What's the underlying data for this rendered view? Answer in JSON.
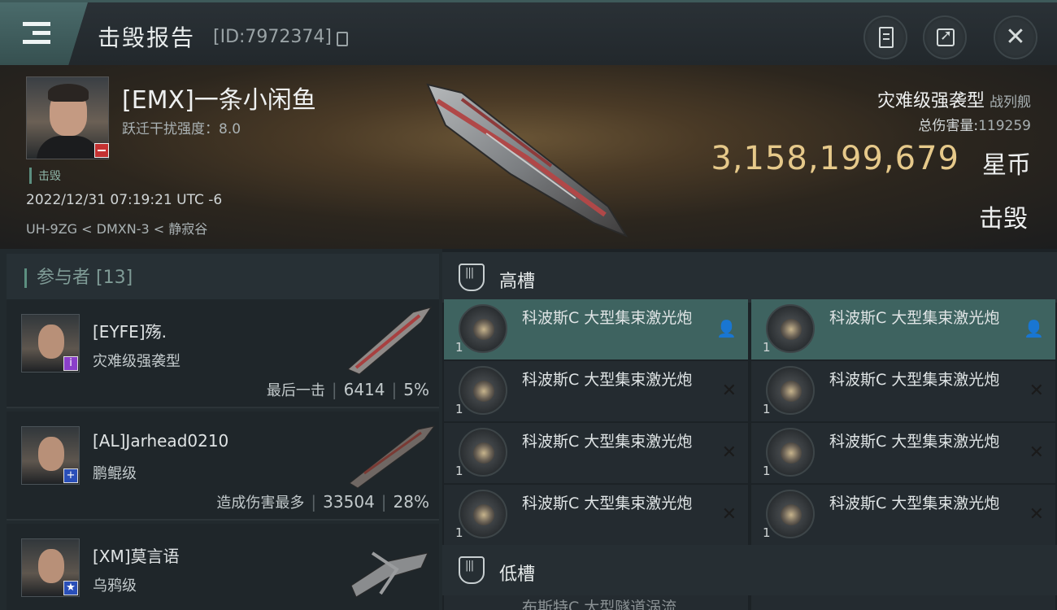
{
  "header": {
    "title": "击毁报告",
    "report_id": "[ID:7972374]"
  },
  "victim": {
    "name": "[EMX]一条小闲鱼",
    "warp_scramble": "跃迁干扰强度：8.0",
    "tag": "击毁",
    "datetime": "2022/12/31 07:19:21 UTC -6",
    "location": "UH-9ZG < DMXN-3 < 静寂谷",
    "ship_name": "灾难级强袭型",
    "ship_class": "战列舰",
    "total_damage_label": "总伤害量:",
    "total_damage_value": "119259",
    "isk_value": "3,158,199,679",
    "isk_unit": "星币",
    "status": "击毁"
  },
  "participants": {
    "header": "参与者 [13]",
    "rows": [
      {
        "name": "[EYFE]殇.",
        "ship": "灾难级强袭型",
        "label": "最后一击",
        "damage": "6414",
        "percent": "5%",
        "badge_color": "#8a3fc9",
        "badge_glyph": "i"
      },
      {
        "name": "[AL]Jarhead0210",
        "ship": "鹏鲲级",
        "label": "造成伤害最多",
        "damage": "33504",
        "percent": "28%",
        "badge_color": "#2a4fb8",
        "badge_glyph": "+"
      },
      {
        "name": "[XM]莫言语",
        "ship": "乌鸦级",
        "badge_color": "#2a4fb8",
        "badge_glyph": "★"
      }
    ]
  },
  "slots": {
    "high_label": "高槽",
    "low_label": "低槽",
    "module_name": "科波斯C 大型集束激光炮",
    "module_qty": "1",
    "low_partial": "布斯特C 大型隧道涡流..."
  },
  "icons": {
    "menu": "hamburger-menu-icon",
    "copy": "copy-icon",
    "list": "document-list-icon",
    "share": "share-icon",
    "close": "close-icon",
    "slot": "slot-icon",
    "pilot": "pilot-icon",
    "destroyed": "x-icon"
  }
}
